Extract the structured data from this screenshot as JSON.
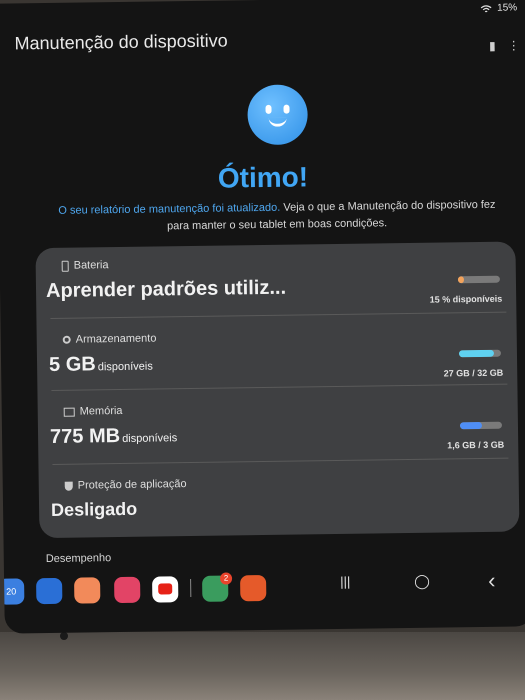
{
  "status_bar": {
    "battery_percent": "15%"
  },
  "header": {
    "title": "Manutenção do dispositivo"
  },
  "hero": {
    "headline": "Ótimo!",
    "desc_highlight": "O seu relatório de manutenção foi atualizado.",
    "desc_rest": "Veja o que a Manutenção do dispositivo fez para manter o seu tablet em boas condições."
  },
  "items": {
    "battery": {
      "label": "Bateria",
      "value": "Aprender padrões utiliz...",
      "detail": "15 % disponíveis",
      "level": 0.15,
      "color": "#f2a35c"
    },
    "storage": {
      "label": "Armazenamento",
      "value": "5 GB",
      "unit": "disponíveis",
      "detail": "27 GB / 32 GB",
      "level": 0.84,
      "color": "#5fd1f0"
    },
    "memory": {
      "label": "Memória",
      "value": "775 MB",
      "unit": "disponíveis",
      "detail": "1,6 GB / 3 GB",
      "level": 0.53,
      "color": "#4f8ef5"
    },
    "app_protection": {
      "label": "Proteção de aplicação",
      "value": "Desligado"
    }
  },
  "performance_label": "Desempenho",
  "dock": {
    "calendar_day": "20",
    "play_badge": "2",
    "apps": [
      "calendar-icon",
      "messages-icon",
      "contacts-icon",
      "camera-icon",
      "youtube-icon",
      "play-store-icon",
      "games-icon"
    ]
  },
  "nav": {
    "recents": "|||",
    "home": "◯",
    "back": "‹"
  }
}
